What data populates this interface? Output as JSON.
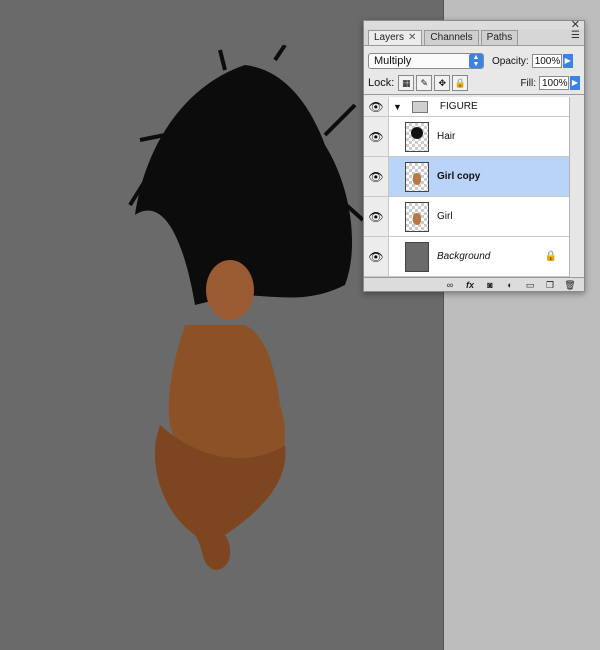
{
  "panel": {
    "tabs": [
      {
        "label": "Layers"
      },
      {
        "label": "Channels"
      },
      {
        "label": "Paths"
      }
    ],
    "blend_mode": "Multiply",
    "opacity_label": "Opacity:",
    "opacity_value": "100%",
    "lock_label": "Lock:",
    "fill_label": "Fill:",
    "fill_value": "100%"
  },
  "layers": [
    {
      "name": "FIGURE"
    },
    {
      "name": "Hair"
    },
    {
      "name": "Girl copy"
    },
    {
      "name": "Girl"
    },
    {
      "name": "Background"
    }
  ],
  "colors": {
    "canvas": "#6a6a6a",
    "pasteboard": "#bdbdbd",
    "selection": "#b9d4f7",
    "accent": "#3b82e6"
  }
}
